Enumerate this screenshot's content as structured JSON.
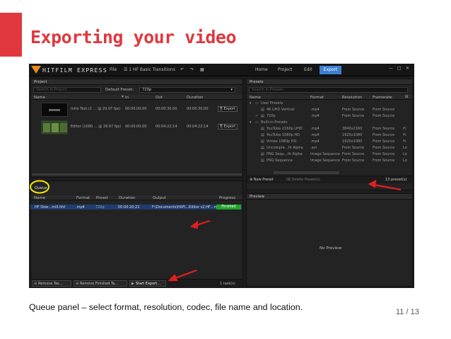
{
  "slide": {
    "title": "Exporting your video",
    "caption": "Queue panel – select format, resolution, codec, file name and location.",
    "page_number": "11 / 13",
    "accent_color": "#e0383e"
  },
  "app": {
    "logo": "HITFILM EXPRESS",
    "menu": [
      "File",
      "1 HF Basic Transitions"
    ],
    "toolbar_icons": [
      "undo-icon",
      "redo-icon",
      "grid-icon"
    ],
    "nav": [
      "Home",
      "Project",
      "Edit",
      "Export"
    ],
    "active_nav": "Export",
    "window_controls": [
      "—",
      "□",
      "✕"
    ]
  },
  "project_panel": {
    "title": "Project",
    "search_placeholder": "Search In Project",
    "default_preset_label": "Default Preset:",
    "default_preset_value": "720p",
    "columns": [
      "Name",
      "In",
      "Out",
      "Duration"
    ],
    "rows": [
      {
        "name": "Intro Text (1 … @ 29.97 fps)",
        "in": "00:00:00;00",
        "out": "00:00:30;00",
        "duration": "00:00:30;00",
        "export": "Export"
      },
      {
        "name": "Editor (1080 … @ 29.97 fps)",
        "in": "00:00:00;00",
        "out": "00:04:22;14",
        "duration": "00:04:22;14",
        "export": "Export"
      }
    ]
  },
  "queue_panel": {
    "title": "Queue",
    "columns": [
      "Name",
      "Format",
      "Preset",
      "Duration",
      "Output",
      "Progress"
    ],
    "row": {
      "name": "HF Dow…mill.hfd",
      "format": ".mp4",
      "preset": "720p",
      "duration": "00:00:20;21",
      "output": "F:\\Documents\\HitFi…Editor v2.HF…mp4",
      "progress": "Finished"
    },
    "buttons": [
      "Remove Tas…",
      "Remove Finished Ta…",
      "Start Export…"
    ],
    "task_count": "1 task(s)",
    "highlight_color": "#22a32a"
  },
  "presets_panel": {
    "title": "Presets",
    "search_placeholder": "Search In Presets",
    "columns": [
      "Name",
      "Format",
      "Resolution",
      "Framerate"
    ],
    "groups": [
      {
        "name": "User Presets",
        "items": [
          {
            "name": "4K UHD Vertical",
            "format": ".mp4",
            "resolution": "From Source",
            "framerate": "From Source"
          },
          {
            "name": "720p",
            "format": ".mp4",
            "resolution": "From Source",
            "framerate": "From Source"
          }
        ]
      },
      {
        "name": "Built-in Presets",
        "items": [
          {
            "name": "YouTube 2160p UHD",
            "format": ".mp4",
            "resolution": "3840x2160",
            "framerate": "From Source",
            "extra": "H."
          },
          {
            "name": "YouTube 1080p HD",
            "format": ".mp4",
            "resolution": "1920x1080",
            "framerate": "From Source",
            "extra": "H."
          },
          {
            "name": "Vimeo 1080p HD",
            "format": ".mp4",
            "resolution": "1920x1080",
            "framerate": "From Source",
            "extra": "H."
          },
          {
            "name": "Uncompre…th Alpha",
            "format": ".avi",
            "resolution": "From Source",
            "framerate": "From Source",
            "extra": "Lo"
          },
          {
            "name": "PNG Sequ…th Alpha",
            "format": "Image Sequence",
            "resolution": "From Source",
            "framerate": "From Source",
            "extra": "Lo"
          },
          {
            "name": "PNG Sequence",
            "format": "Image Sequence",
            "resolution": "From Source",
            "framerate": "From Source",
            "extra": "Lo"
          }
        ]
      }
    ],
    "new_preset": "New Preset",
    "delete_preset": "Delete Preset(s)",
    "preset_count": "13 preset(s)"
  },
  "preview_panel": {
    "title": "Preview",
    "empty_text": "No Preview"
  }
}
